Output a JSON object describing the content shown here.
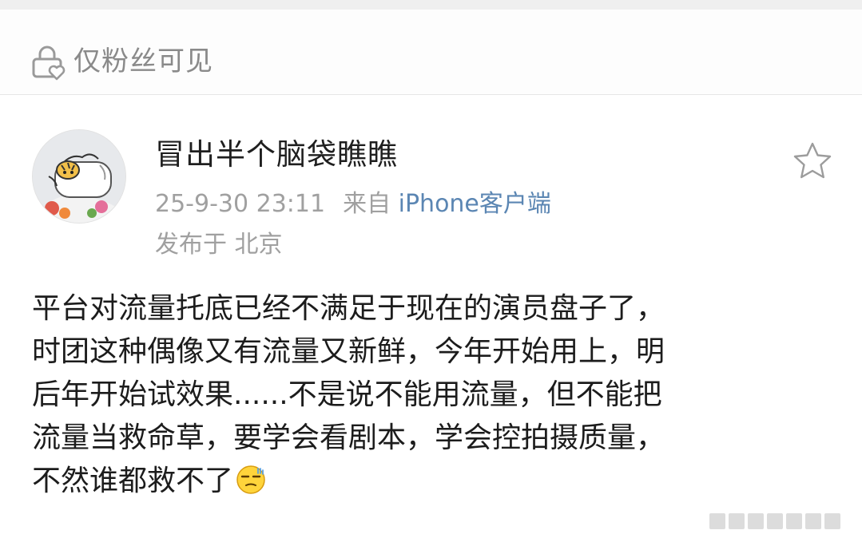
{
  "visibility": {
    "label": "仅粉丝可见"
  },
  "post": {
    "author": "冒出半个脑袋瞧瞧",
    "timestamp": "25-9-30 23:11",
    "source_prefix": "来自",
    "source": "iPhone客户端",
    "location_prefix": "发布于",
    "location": "北京",
    "body_lines": [
      "平台对流量托底已经不满足于现在的演员盘子了，",
      "时团这种偶像又有流量又新鲜，今年开始用上，明",
      "后年开始试效果......不是说不能用流量，但不能把",
      "流量当救命草，要学会看剧本，学会控拍摄质量，",
      "不然谁都救不了"
    ],
    "emoji": "cold-sweat-emoji"
  },
  "icons": {
    "visibility": "lock-heart-icon",
    "favorite": "star-outline-icon",
    "avatar": "cartoon-tiger-avatar"
  },
  "colors": {
    "link": "#5b86b3",
    "meta": "#a0a0a0",
    "text": "#1c1c1c",
    "muted": "#8a8a8a"
  }
}
